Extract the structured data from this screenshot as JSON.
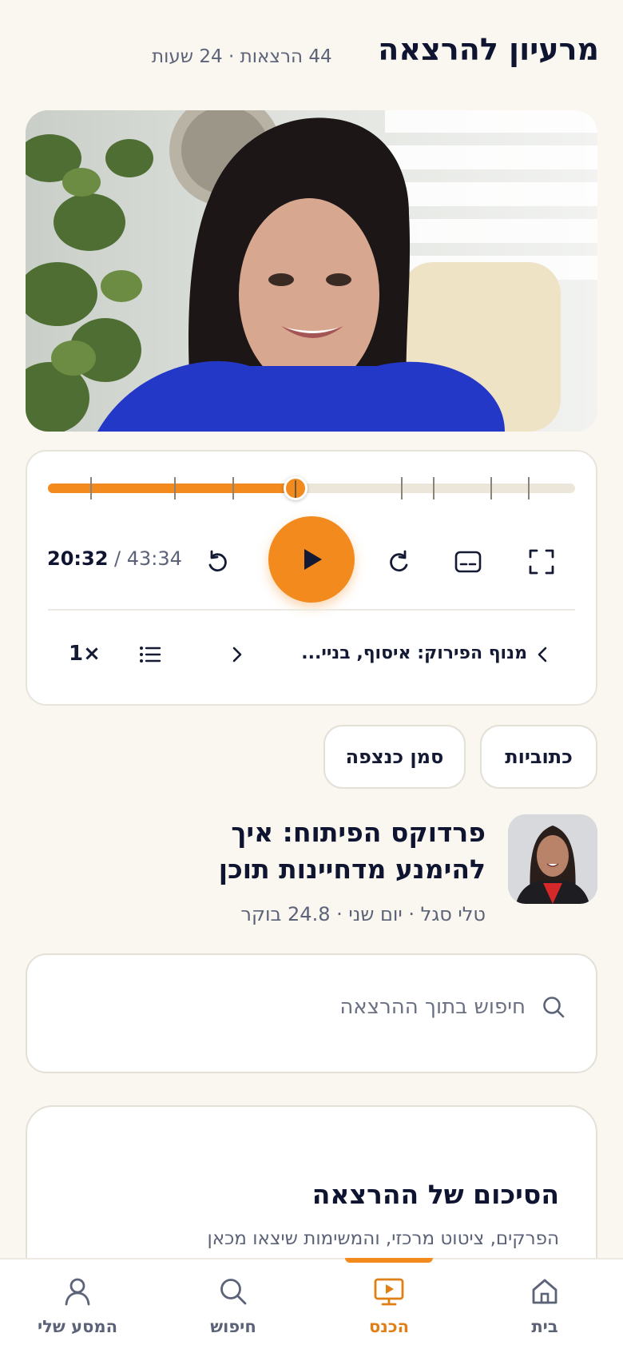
{
  "header": {
    "title": "מרעיון להרצאה",
    "meta": "44 הרצאות · 24 שעות"
  },
  "player": {
    "current_time": "20:32",
    "total_time": "/ 43:34",
    "progress": 0.47,
    "chapter_marks": [
      0.08,
      0.24,
      0.35,
      0.47,
      0.67,
      0.73,
      0.84,
      0.91
    ],
    "chapter_label": "מנוף הפירוק: איסוף, בניי...",
    "speed_label": "1×",
    "accent_color": "#f28a1e"
  },
  "actions": {
    "subtitles_label": "כתוביות",
    "bookmark_label": "סמן כנצפה"
  },
  "lecture": {
    "title": "פרדוקס הפיתוח: איך להימנע מדחיינות תוכן",
    "meta": "טלי סגל · יום שני · 24.8 בוקר"
  },
  "search": {
    "placeholder": "חיפוש בתוך ההרצאה"
  },
  "summary": {
    "title": "הסיכום של ההרצאה",
    "subtitle": "הפרקים, ציטוט מרכזי, והמשימות שיצאו מכאן"
  },
  "nav": {
    "items": [
      {
        "label": "בית",
        "icon": "home-icon"
      },
      {
        "label": "הכנס",
        "icon": "conference-icon",
        "active": true
      },
      {
        "label": "חיפוש",
        "icon": "search-icon"
      },
      {
        "label": "המסע שלי",
        "icon": "user-icon"
      }
    ]
  }
}
